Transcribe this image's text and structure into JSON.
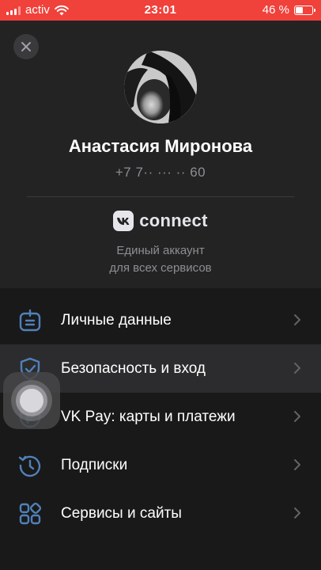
{
  "status_bar": {
    "carrier": "activ",
    "time": "23:01",
    "battery": "46 %",
    "battery_level": 0.46
  },
  "header": {
    "close_icon": "close-icon",
    "name": "Анастасия Миронова",
    "phone": "+7 7·· ··· ·· 60",
    "brand": "connect",
    "tagline_line1": "Единый аккаунт",
    "tagline_line2": "для всех сервисов"
  },
  "menu": {
    "items": [
      {
        "label": "Личные данные",
        "icon": "id-card-icon"
      },
      {
        "label": "Безопасность и вход",
        "icon": "shield-icon"
      },
      {
        "label": "VK Pay: карты и платежи",
        "icon": "ruble-coin-icon"
      },
      {
        "label": "Подписки",
        "icon": "clock-icon"
      },
      {
        "label": "Сервисы и сайты",
        "icon": "grid-icon"
      }
    ]
  },
  "colors": {
    "status_bar": "#f0413b",
    "background": "#19191a",
    "card": "#232324",
    "accent_icon": "#5181b8",
    "muted_text": "#8e8e93"
  }
}
